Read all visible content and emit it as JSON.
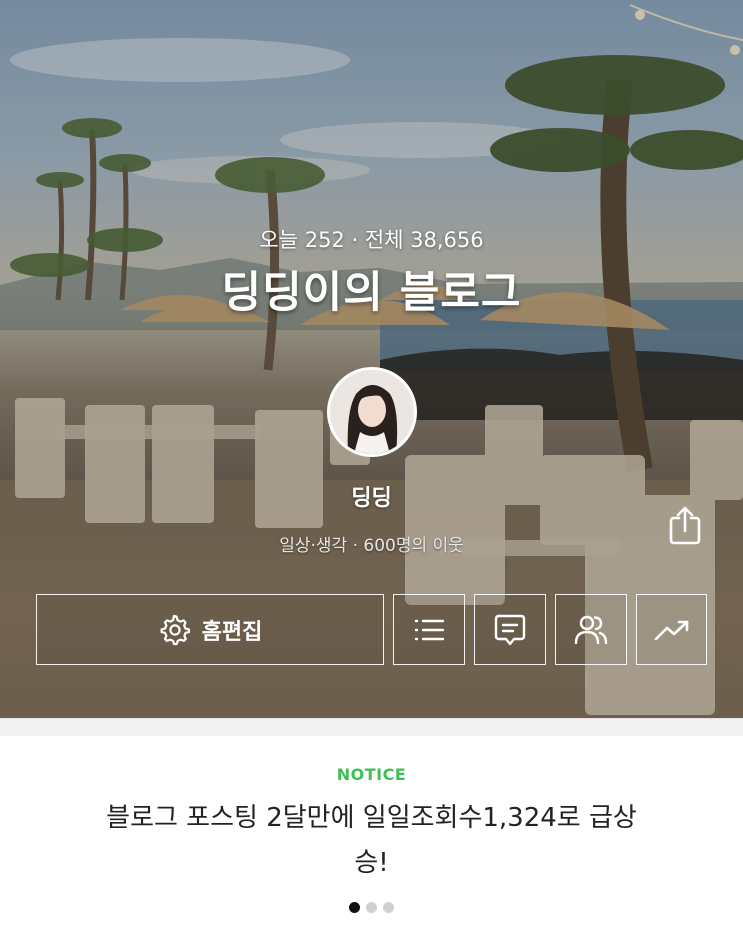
{
  "blog": {
    "stats_text": "오늘 252 · 전체 38,656",
    "title": "딩딩이의 블로그",
    "nickname": "딩딩",
    "meta_text": "일상·생각 · 600명의 이웃"
  },
  "actions": {
    "home_edit_label": "홈편집",
    "list_icon": "list-icon",
    "memo_icon": "memo-icon",
    "neighbor_icon": "neighbors-icon",
    "stats_icon": "trend-icon",
    "share_icon": "share-icon"
  },
  "notice": {
    "label": "NOTICE",
    "text": "블로그 포스팅 2달만에 일일조회수1,324로 급상승!"
  },
  "pager": {
    "count": 3,
    "active": 0
  },
  "colors": {
    "notice_green": "#3fbf55",
    "dot_active": "#111111",
    "dot_inactive": "#d0d0d0"
  }
}
